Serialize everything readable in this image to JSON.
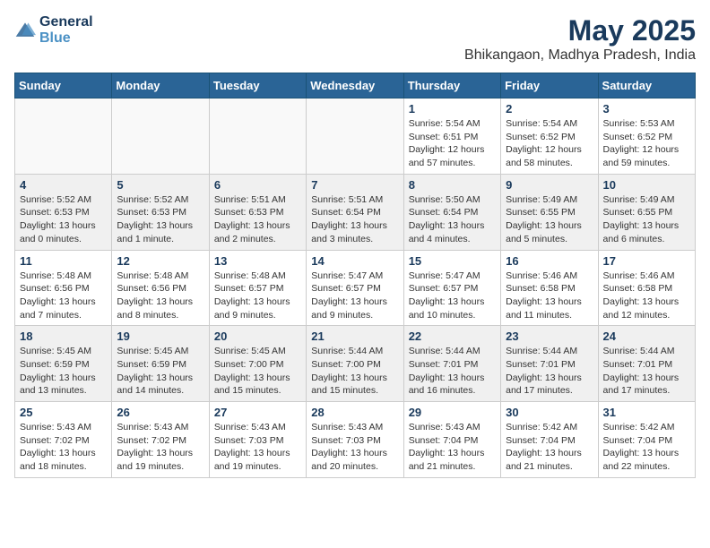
{
  "logo": {
    "line1": "General",
    "line2": "Blue"
  },
  "title": "May 2025",
  "location": "Bhikangaon, Madhya Pradesh, India",
  "weekdays": [
    "Sunday",
    "Monday",
    "Tuesday",
    "Wednesday",
    "Thursday",
    "Friday",
    "Saturday"
  ],
  "weeks": [
    [
      {
        "day": "",
        "info": ""
      },
      {
        "day": "",
        "info": ""
      },
      {
        "day": "",
        "info": ""
      },
      {
        "day": "",
        "info": ""
      },
      {
        "day": "1",
        "info": "Sunrise: 5:54 AM\nSunset: 6:51 PM\nDaylight: 12 hours\nand 57 minutes."
      },
      {
        "day": "2",
        "info": "Sunrise: 5:54 AM\nSunset: 6:52 PM\nDaylight: 12 hours\nand 58 minutes."
      },
      {
        "day": "3",
        "info": "Sunrise: 5:53 AM\nSunset: 6:52 PM\nDaylight: 12 hours\nand 59 minutes."
      }
    ],
    [
      {
        "day": "4",
        "info": "Sunrise: 5:52 AM\nSunset: 6:53 PM\nDaylight: 13 hours\nand 0 minutes."
      },
      {
        "day": "5",
        "info": "Sunrise: 5:52 AM\nSunset: 6:53 PM\nDaylight: 13 hours\nand 1 minute."
      },
      {
        "day": "6",
        "info": "Sunrise: 5:51 AM\nSunset: 6:53 PM\nDaylight: 13 hours\nand 2 minutes."
      },
      {
        "day": "7",
        "info": "Sunrise: 5:51 AM\nSunset: 6:54 PM\nDaylight: 13 hours\nand 3 minutes."
      },
      {
        "day": "8",
        "info": "Sunrise: 5:50 AM\nSunset: 6:54 PM\nDaylight: 13 hours\nand 4 minutes."
      },
      {
        "day": "9",
        "info": "Sunrise: 5:49 AM\nSunset: 6:55 PM\nDaylight: 13 hours\nand 5 minutes."
      },
      {
        "day": "10",
        "info": "Sunrise: 5:49 AM\nSunset: 6:55 PM\nDaylight: 13 hours\nand 6 minutes."
      }
    ],
    [
      {
        "day": "11",
        "info": "Sunrise: 5:48 AM\nSunset: 6:56 PM\nDaylight: 13 hours\nand 7 minutes."
      },
      {
        "day": "12",
        "info": "Sunrise: 5:48 AM\nSunset: 6:56 PM\nDaylight: 13 hours\nand 8 minutes."
      },
      {
        "day": "13",
        "info": "Sunrise: 5:48 AM\nSunset: 6:57 PM\nDaylight: 13 hours\nand 9 minutes."
      },
      {
        "day": "14",
        "info": "Sunrise: 5:47 AM\nSunset: 6:57 PM\nDaylight: 13 hours\nand 9 minutes."
      },
      {
        "day": "15",
        "info": "Sunrise: 5:47 AM\nSunset: 6:57 PM\nDaylight: 13 hours\nand 10 minutes."
      },
      {
        "day": "16",
        "info": "Sunrise: 5:46 AM\nSunset: 6:58 PM\nDaylight: 13 hours\nand 11 minutes."
      },
      {
        "day": "17",
        "info": "Sunrise: 5:46 AM\nSunset: 6:58 PM\nDaylight: 13 hours\nand 12 minutes."
      }
    ],
    [
      {
        "day": "18",
        "info": "Sunrise: 5:45 AM\nSunset: 6:59 PM\nDaylight: 13 hours\nand 13 minutes."
      },
      {
        "day": "19",
        "info": "Sunrise: 5:45 AM\nSunset: 6:59 PM\nDaylight: 13 hours\nand 14 minutes."
      },
      {
        "day": "20",
        "info": "Sunrise: 5:45 AM\nSunset: 7:00 PM\nDaylight: 13 hours\nand 15 minutes."
      },
      {
        "day": "21",
        "info": "Sunrise: 5:44 AM\nSunset: 7:00 PM\nDaylight: 13 hours\nand 15 minutes."
      },
      {
        "day": "22",
        "info": "Sunrise: 5:44 AM\nSunset: 7:01 PM\nDaylight: 13 hours\nand 16 minutes."
      },
      {
        "day": "23",
        "info": "Sunrise: 5:44 AM\nSunset: 7:01 PM\nDaylight: 13 hours\nand 17 minutes."
      },
      {
        "day": "24",
        "info": "Sunrise: 5:44 AM\nSunset: 7:01 PM\nDaylight: 13 hours\nand 17 minutes."
      }
    ],
    [
      {
        "day": "25",
        "info": "Sunrise: 5:43 AM\nSunset: 7:02 PM\nDaylight: 13 hours\nand 18 minutes."
      },
      {
        "day": "26",
        "info": "Sunrise: 5:43 AM\nSunset: 7:02 PM\nDaylight: 13 hours\nand 19 minutes."
      },
      {
        "day": "27",
        "info": "Sunrise: 5:43 AM\nSunset: 7:03 PM\nDaylight: 13 hours\nand 19 minutes."
      },
      {
        "day": "28",
        "info": "Sunrise: 5:43 AM\nSunset: 7:03 PM\nDaylight: 13 hours\nand 20 minutes."
      },
      {
        "day": "29",
        "info": "Sunrise: 5:43 AM\nSunset: 7:04 PM\nDaylight: 13 hours\nand 21 minutes."
      },
      {
        "day": "30",
        "info": "Sunrise: 5:42 AM\nSunset: 7:04 PM\nDaylight: 13 hours\nand 21 minutes."
      },
      {
        "day": "31",
        "info": "Sunrise: 5:42 AM\nSunset: 7:04 PM\nDaylight: 13 hours\nand 22 minutes."
      }
    ]
  ]
}
